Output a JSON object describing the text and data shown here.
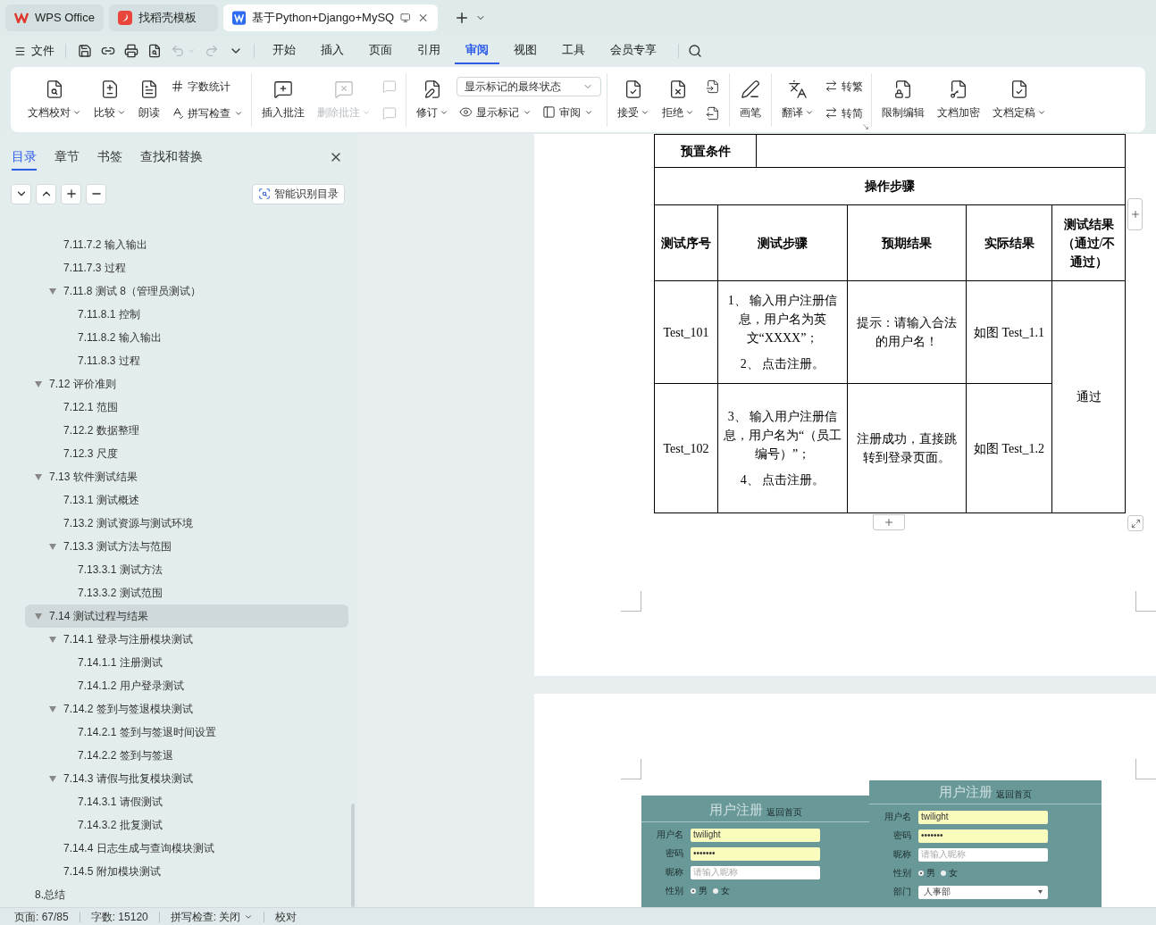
{
  "titlebar": {
    "tabs": [
      {
        "kind": "wps",
        "label": "WPS Office",
        "selected": false
      },
      {
        "kind": "docer",
        "label": "找稻壳模板",
        "selected": false
      },
      {
        "kind": "doc",
        "label": "基于Python+Django+MySQ",
        "selected": true
      }
    ]
  },
  "menu": {
    "file_label": "文件",
    "quick_access": [
      {
        "disabled": false,
        "caret": false
      },
      {
        "disabled": false,
        "caret": false
      },
      {
        "disabled": false,
        "caret": false
      },
      {
        "disabled": false,
        "caret": false
      },
      {
        "disabled": true,
        "caret": true
      },
      {
        "disabled": true,
        "caret": false
      }
    ],
    "tabs": [
      {
        "label": "开始",
        "selected": false
      },
      {
        "label": "插入",
        "selected": false
      },
      {
        "label": "页面",
        "selected": false
      },
      {
        "label": "引用",
        "selected": false
      },
      {
        "label": "审阅",
        "selected": true
      },
      {
        "label": "视图",
        "selected": false
      },
      {
        "label": "工具",
        "selected": false
      },
      {
        "label": "会员专享",
        "selected": false
      }
    ]
  },
  "ribbon": [
    {
      "items": [
        {
          "kind": "large",
          "label": "文档校对",
          "caret": true,
          "disabled": false
        },
        {
          "kind": "large",
          "label": "比较",
          "caret": true,
          "disabled": false
        },
        {
          "kind": "large",
          "label": "朗读",
          "caret": false,
          "disabled": false
        },
        {
          "kind": "stack",
          "items": [
            {
              "kind": "small",
              "label": "字数统计",
              "caret": false,
              "disabled": false
            },
            {
              "kind": "small",
              "label": "拼写检查",
              "caret": true,
              "disabled": false
            }
          ]
        }
      ]
    },
    {
      "items": [
        {
          "kind": "large",
          "label": "插入批注",
          "caret": false,
          "disabled": false
        },
        {
          "kind": "large",
          "label": "删除批注",
          "caret": true,
          "disabled": true
        },
        {
          "kind": "stack",
          "items": [
            {
              "kind": "icon",
              "disabled": true
            },
            {
              "kind": "icon",
              "disabled": true
            }
          ]
        }
      ]
    },
    {
      "items": [
        {
          "kind": "large",
          "label": "修订",
          "caret": true,
          "disabled": false
        },
        {
          "kind": "stack",
          "items": [
            {
              "kind": "select",
              "value": "显示标记的最终状态"
            },
            {
              "kind": "row",
              "items": [
                {
                  "kind": "small",
                  "label": "显示标记",
                  "caret": true,
                  "disabled": false
                },
                {
                  "kind": "small",
                  "label": "审阅",
                  "caret": true,
                  "disabled": false
                }
              ]
            }
          ]
        }
      ]
    },
    {
      "items": [
        {
          "kind": "large",
          "label": "接受",
          "caret": true,
          "disabled": false
        },
        {
          "kind": "large",
          "label": "拒绝",
          "caret": true,
          "disabled": false
        },
        {
          "kind": "stack",
          "items": [
            {
              "kind": "icon",
              "disabled": false
            },
            {
              "kind": "icon",
              "disabled": false
            }
          ]
        }
      ]
    },
    {
      "items": [
        {
          "kind": "large",
          "label": "画笔",
          "caret": false,
          "disabled": false
        }
      ]
    },
    {
      "launcher": true,
      "items": [
        {
          "kind": "large",
          "label": "翻译",
          "caret": true,
          "disabled": false
        },
        {
          "kind": "stack",
          "items": [
            {
              "kind": "small",
              "label": "转繁",
              "caret": false,
              "disabled": false
            },
            {
              "kind": "small",
              "label": "转简",
              "caret": false,
              "disabled": false
            }
          ]
        }
      ]
    },
    {
      "items": [
        {
          "kind": "large",
          "label": "限制编辑",
          "caret": false,
          "disabled": false
        },
        {
          "kind": "large",
          "label": "文档加密",
          "caret": false,
          "disabled": false
        },
        {
          "kind": "large",
          "label": "文档定稿",
          "caret": true,
          "disabled": false
        }
      ]
    }
  ],
  "sidebar": {
    "tabs": [
      {
        "label": "目录",
        "selected": true
      },
      {
        "label": "章节",
        "selected": false
      },
      {
        "label": "书签",
        "selected": false
      },
      {
        "label": "查找和替换",
        "selected": false
      }
    ],
    "smart_button": "智能识别目录",
    "toc": [
      {
        "children": [
          {
            "children": [
              {
                "label": "7.11.7.2 输入输出",
                "selected": false
              },
              {
                "label": "7.11.7.3 过程",
                "selected": false
              },
              {
                "label": "7.11.8 测试 8（管理员测试）",
                "selected": false,
                "expanded": true,
                "children": [
                  {
                    "label": "7.11.8.1 控制",
                    "selected": false
                  },
                  {
                    "label": "7.11.8.2 输入输出",
                    "selected": false
                  },
                  {
                    "label": "7.11.8.3 过程",
                    "selected": false
                  }
                ]
              }
            ]
          },
          {
            "label": "7.12 评价准则",
            "selected": false,
            "expanded": true,
            "children": [
              {
                "label": "7.12.1 范围",
                "selected": false
              },
              {
                "label": "7.12.2 数据整理",
                "selected": false
              },
              {
                "label": "7.12.3 尺度",
                "selected": false
              }
            ]
          },
          {
            "label": "7.13 软件测试结果",
            "selected": false,
            "expanded": true,
            "children": [
              {
                "label": "7.13.1 测试概述",
                "selected": false
              },
              {
                "label": "7.13.2 测试资源与测试环境",
                "selected": false
              },
              {
                "label": "7.13.3 测试方法与范围",
                "selected": false,
                "expanded": true,
                "children": [
                  {
                    "label": "7.13.3.1 测试方法",
                    "selected": false
                  },
                  {
                    "label": "7.13.3.2 测试范围",
                    "selected": false
                  }
                ]
              }
            ]
          },
          {
            "label": "7.14 测试过程与结果",
            "selected": true,
            "expanded": true,
            "children": [
              {
                "label": "7.14.1 登录与注册模块测试",
                "selected": false,
                "expanded": true,
                "children": [
                  {
                    "label": "7.14.1.1 注册测试",
                    "selected": false
                  },
                  {
                    "label": "7.14.1.2 用户登录测试",
                    "selected": false
                  }
                ]
              },
              {
                "label": "7.14.2 签到与签退模块测试",
                "selected": false,
                "expanded": true,
                "children": [
                  {
                    "label": "7.14.2.1 签到与签退时间设置",
                    "selected": false
                  },
                  {
                    "label": "7.14.2.2 签到与签退",
                    "selected": false
                  }
                ]
              },
              {
                "label": "7.14.3 请假与批复模块测试",
                "selected": false,
                "expanded": true,
                "children": [
                  {
                    "label": "7.14.3.1 请假测试",
                    "selected": false
                  },
                  {
                    "label": "7.14.3.2 批复测试",
                    "selected": false
                  }
                ]
              },
              {
                "label": "7.14.4 日志生成与查询模块测试",
                "selected": false
              },
              {
                "label": "7.14.5 附加模块测试",
                "selected": false
              }
            ]
          }
        ]
      },
      {
        "label": "8.总结",
        "selected": false
      }
    ]
  },
  "document": {
    "table": {
      "precondition_label": "预置条件",
      "section_title": "操作步骤",
      "columns": [
        "测试序号",
        "测试步骤",
        "预期结果",
        "实际结果",
        "测试结果（通过/不通过）"
      ],
      "rows": [
        {
          "id": "Test_101",
          "steps": [
            "1、 输入用户注册信息，用户名为英文“XXXX”；",
            "2、 点击注册。"
          ],
          "expected": "提示：请输入合法的用户名！",
          "actual": "如图 Test_1.1"
        },
        {
          "id": "Test_102",
          "steps": [
            "3、 输入用户注册信息，用户名为“（员工编号）”；",
            "4、 点击注册。"
          ],
          "expected": "注册成功，直接跳转到登录页面。",
          "actual": "如图 Test_1.2"
        }
      ],
      "result": "通过"
    },
    "screenshots": [
      {
        "title": "用户注册",
        "link": "返回首页",
        "fields": [
          {
            "kind": "text",
            "label": "用户名",
            "value": "twilight",
            "autofilled": true
          },
          {
            "kind": "text",
            "label": "密码",
            "value": "•••••••",
            "autofilled": true
          },
          {
            "kind": "text",
            "label": "昵称",
            "placeholder": "请输入昵称",
            "autofilled": false
          },
          {
            "kind": "radio",
            "label": "性别",
            "options": [
              {
                "label": "男",
                "selected": true
              },
              {
                "label": "女",
                "selected": false
              }
            ]
          }
        ]
      },
      {
        "title": "用户注册",
        "link": "返回首页",
        "fields": [
          {
            "kind": "text",
            "label": "用户名",
            "value": "twilight",
            "autofilled": true
          },
          {
            "kind": "text",
            "label": "密码",
            "value": "•••••••",
            "autofilled": true
          },
          {
            "kind": "text",
            "label": "昵称",
            "placeholder": "请输入昵称",
            "autofilled": false
          },
          {
            "kind": "radio",
            "label": "性别",
            "options": [
              {
                "label": "男",
                "selected": true
              },
              {
                "label": "女",
                "selected": false
              }
            ]
          },
          {
            "kind": "select",
            "label": "部门",
            "value": "人事部"
          }
        ]
      }
    ]
  },
  "status_bar": {
    "page": "页面: 67/85",
    "words": "字数: 15120",
    "spell": "拼写检查: 关闭",
    "proof": "校对"
  }
}
